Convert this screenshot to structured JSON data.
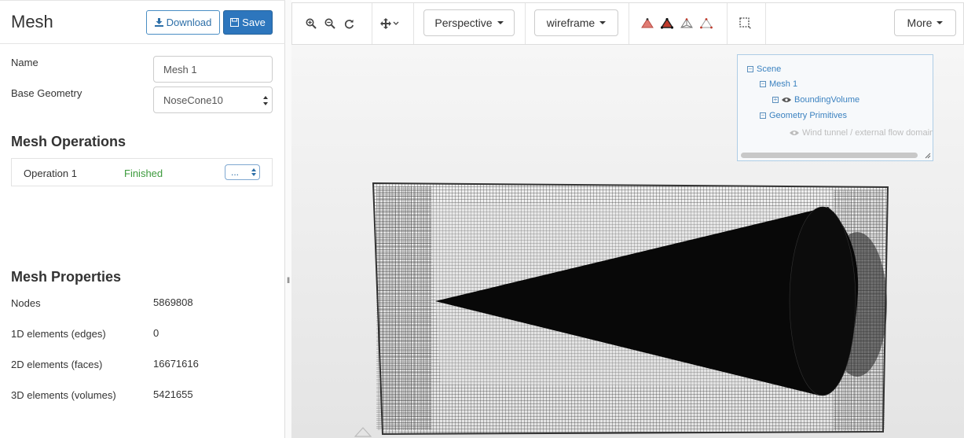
{
  "panel": {
    "title": "Mesh",
    "download_label": "Download",
    "save_label": "Save",
    "name_label": "Name",
    "name_value": "Mesh 1",
    "base_geometry_label": "Base Geometry",
    "base_geometry_value": "NoseCone10"
  },
  "operations": {
    "title": "Mesh Operations",
    "items": [
      {
        "name": "Operation 1",
        "status": "Finished",
        "action": "..."
      }
    ]
  },
  "properties": {
    "title": "Mesh Properties",
    "rows": [
      {
        "label": "Nodes",
        "value": "5869808"
      },
      {
        "label": "1D elements (edges)",
        "value": "0"
      },
      {
        "label": "2D elements (faces)",
        "value": "16671616"
      },
      {
        "label": "3D elements (volumes)",
        "value": "5421655"
      }
    ]
  },
  "toolbar": {
    "projection": "Perspective",
    "render_mode": "wireframe",
    "more_label": "More"
  },
  "scene_tree": {
    "root": "Scene",
    "mesh": "Mesh 1",
    "bounding": "BoundingVolume",
    "primitives": "Geometry Primitives",
    "wind_tunnel": "Wind tunnel / external flow domain"
  },
  "colors": {
    "accent": "#2d76bd",
    "status_ok": "#3c9a3c",
    "link": "#3b82c0"
  }
}
